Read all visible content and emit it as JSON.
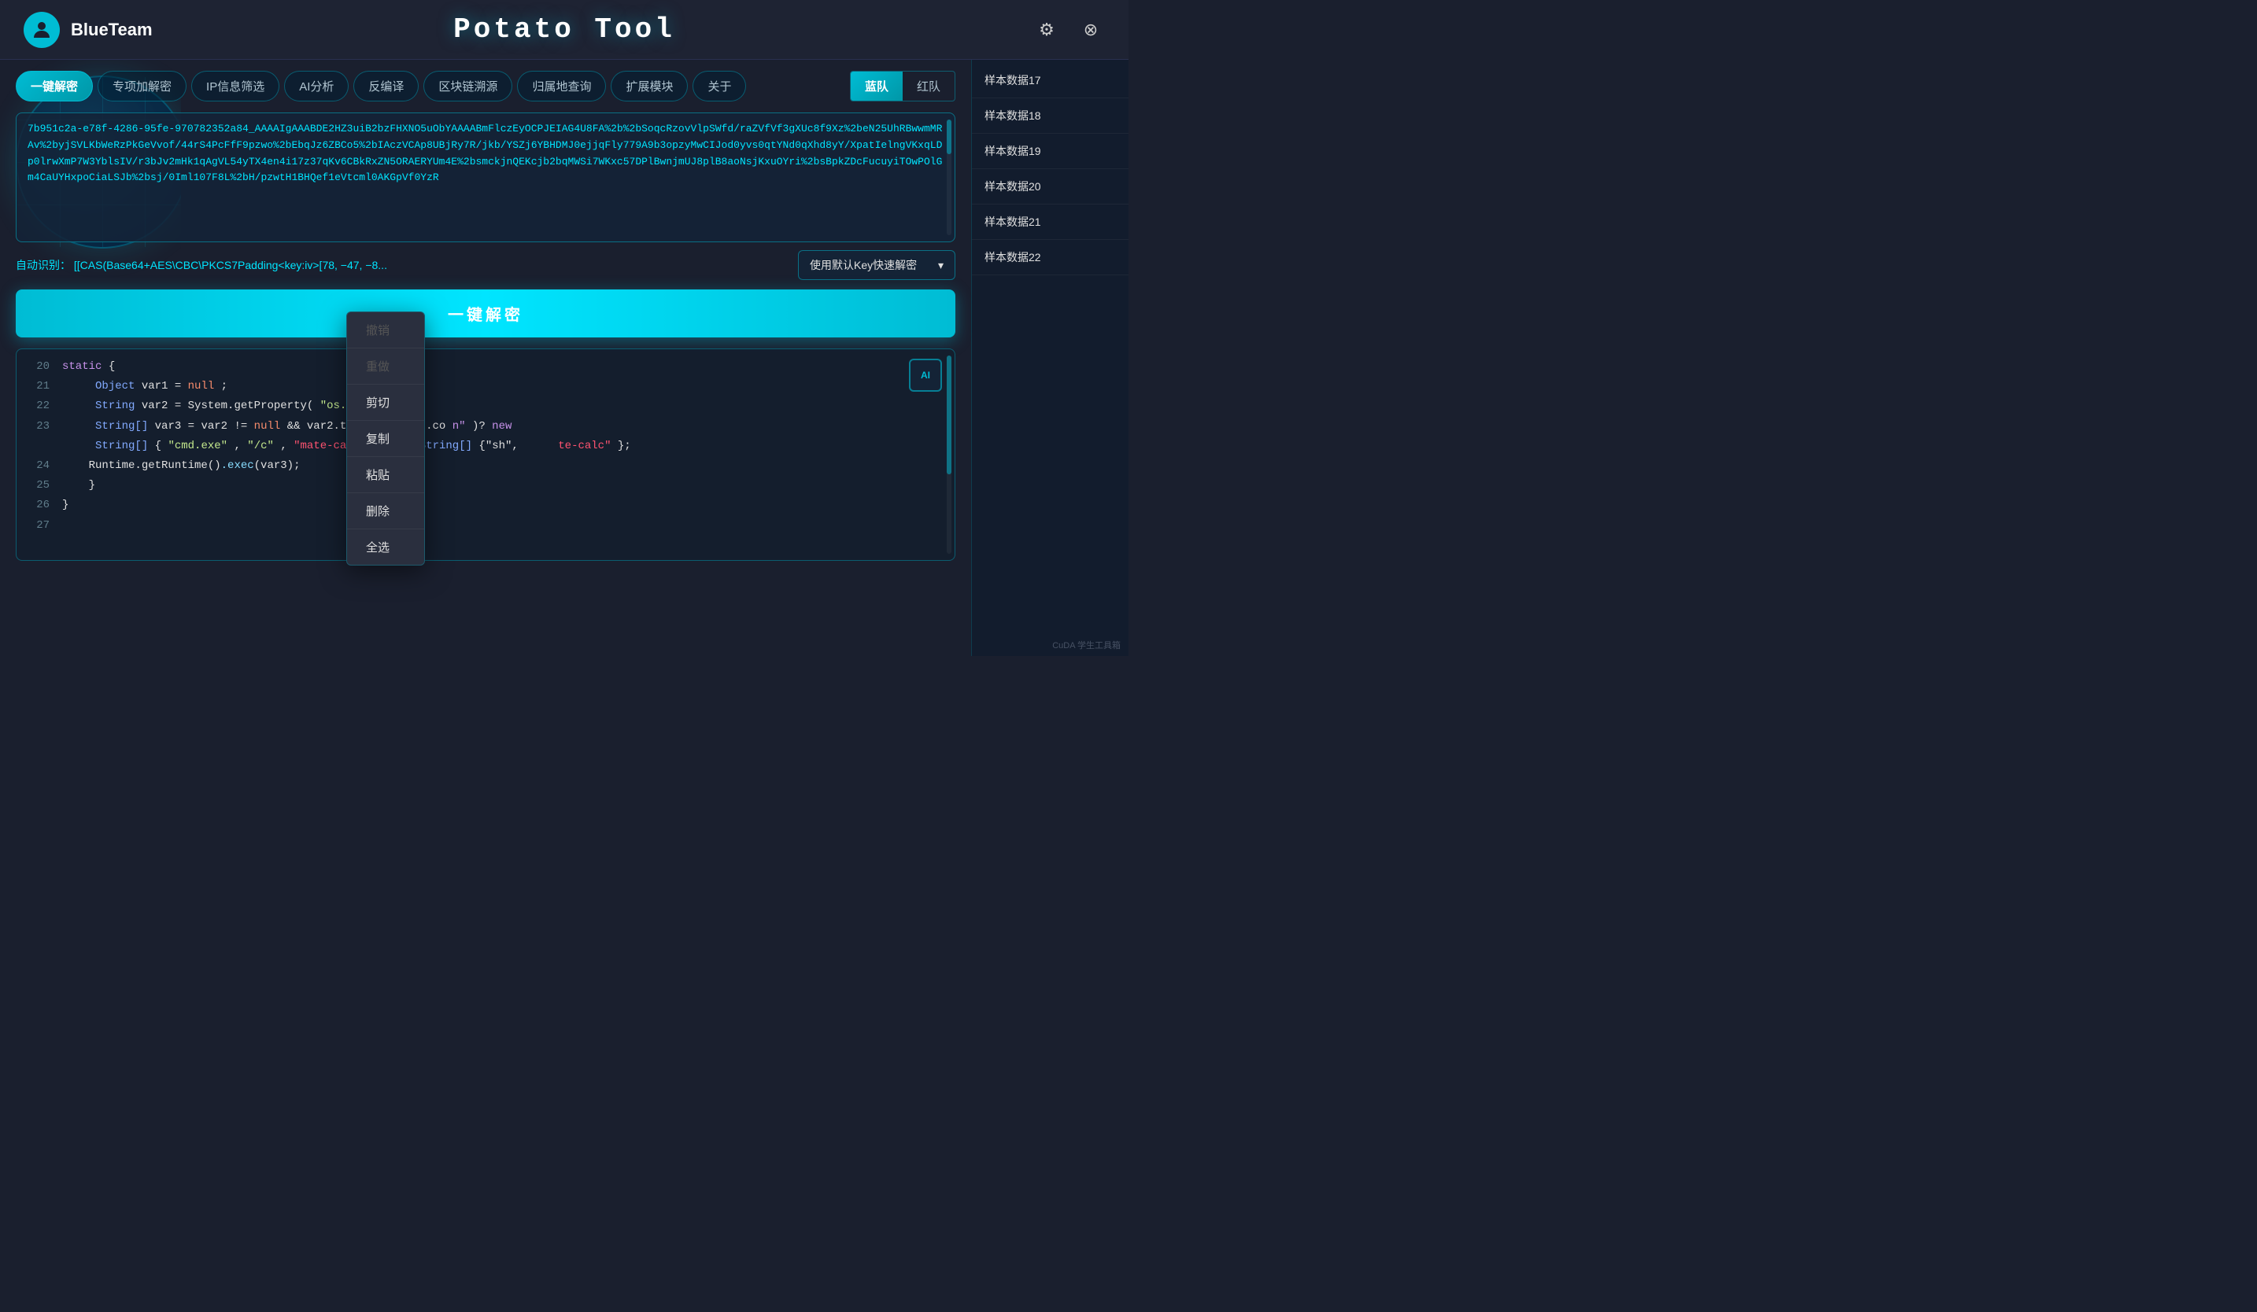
{
  "titleBar": {
    "appName": "BlueTeam",
    "appTitle": "Potato Tool",
    "settingsIcon": "⚙",
    "closeIcon": "⊗"
  },
  "nav": {
    "tabs": [
      {
        "id": "one-click",
        "label": "一键解密",
        "active": true
      },
      {
        "id": "special",
        "label": "专项加解密",
        "active": false
      },
      {
        "id": "ip",
        "label": "IP信息筛选",
        "active": false
      },
      {
        "id": "ai",
        "label": "AI分析",
        "active": false
      },
      {
        "id": "decompile",
        "label": "反编译",
        "active": false
      },
      {
        "id": "blockchain",
        "label": "区块链溯源",
        "active": false
      },
      {
        "id": "geo",
        "label": "归属地查询",
        "active": false
      },
      {
        "id": "extend",
        "label": "扩展模块",
        "active": false
      },
      {
        "id": "about",
        "label": "关于",
        "active": false
      }
    ],
    "teamSwitch": {
      "blue": "蓝队",
      "red": "红队",
      "activeTeam": "blue"
    }
  },
  "inputArea": {
    "text": "7b951c2a-e78f-4286-95fe-970782352a84_AAAAIgAAABDE2HZ3uiB2bzFHXNO5uObYAAAABmFlczEyOCPJEIAG4U8FA%2b%2bSoqcRzovVlpSWfd/raZVfVf3gXUc8f9Xz%2beN25UhRBwwmMRAv%2byjSVLKbWeRzPkGeVvof/44rS4PcFfF9pzwo%2bEbqJz6ZBCo5%2bIAczVCAp8UBjRy7R/jkb/YSZj6YBHDMJ0ejjqFly779A9b3opzyMwCIJod0yvs0qtYNd0qXhd8yY/XpatIelngVKxqLDp0lrwXmP7W3YblsIV/r3bJv2mHk1qAgVL54yTX4en4i17z37qKv6CBkRxZN5ORAERYUm4E%2bsmckjnQEKcjb2bqMWSi7WKxc57DPlBwnjmUJ8plB8aoNsjKxuOYri%2bsBpkZDcFucuyiTOwPOlGm4CaUYHxpoCiaLSJb%2bsj/0Iml107F8L%2bH/pzwtH1BHQef1eVtcml0AKGpVf0YzR"
  },
  "autoDetect": {
    "label": "自动识别：",
    "text": "[[CAS(Base64+AES\\CBC\\PKCS7Padding<key:iv>[78, −47, −8...",
    "selectLabel": "使用默认Key快速解密",
    "chevron": "▾"
  },
  "decryptButton": {
    "label": "一键解密"
  },
  "codeArea": {
    "lines": [
      {
        "num": "20",
        "content": "static {",
        "type": "static_open"
      },
      {
        "num": "21",
        "content": "Object var1 = null;",
        "type": "normal"
      },
      {
        "num": "22",
        "content": "String var2 = System.getProperty(\"os.name\");",
        "type": "string"
      },
      {
        "num": "23",
        "content": "String[] var3 = var2 != null && var2.toLowerCase().co...",
        "type": "complex"
      },
      {
        "num": "23b",
        "content": "String[]{\"cmd.exe\", \"/c\", \"mate-calc\"}:new String[]{\"sh\",",
        "type": "complex2"
      },
      {
        "num": "24",
        "content": "Runtime.getRuntime().exec(var3);",
        "type": "normal"
      },
      {
        "num": "25",
        "content": "}",
        "type": "close"
      },
      {
        "num": "26",
        "content": "}",
        "type": "close"
      },
      {
        "num": "27",
        "content": "",
        "type": "empty"
      }
    ]
  },
  "contextMenu": {
    "items": [
      {
        "label": "撤销",
        "disabled": true
      },
      {
        "label": "重做",
        "disabled": true
      },
      {
        "label": "剪切",
        "disabled": false
      },
      {
        "label": "复制",
        "disabled": false
      },
      {
        "label": "粘贴",
        "disabled": false
      },
      {
        "label": "删除",
        "disabled": false
      },
      {
        "label": "全选",
        "disabled": false
      }
    ]
  },
  "rightSidebar": {
    "scrollLabel": "样本数据",
    "items": [
      {
        "label": "样本数据17"
      },
      {
        "label": "样本数据18"
      },
      {
        "label": "样本数据19"
      },
      {
        "label": "样本数据20"
      },
      {
        "label": "样本数据21"
      },
      {
        "label": "样本数据22"
      }
    ]
  },
  "watermark": "CuDA 学生工具箱",
  "aiButton": "AI"
}
